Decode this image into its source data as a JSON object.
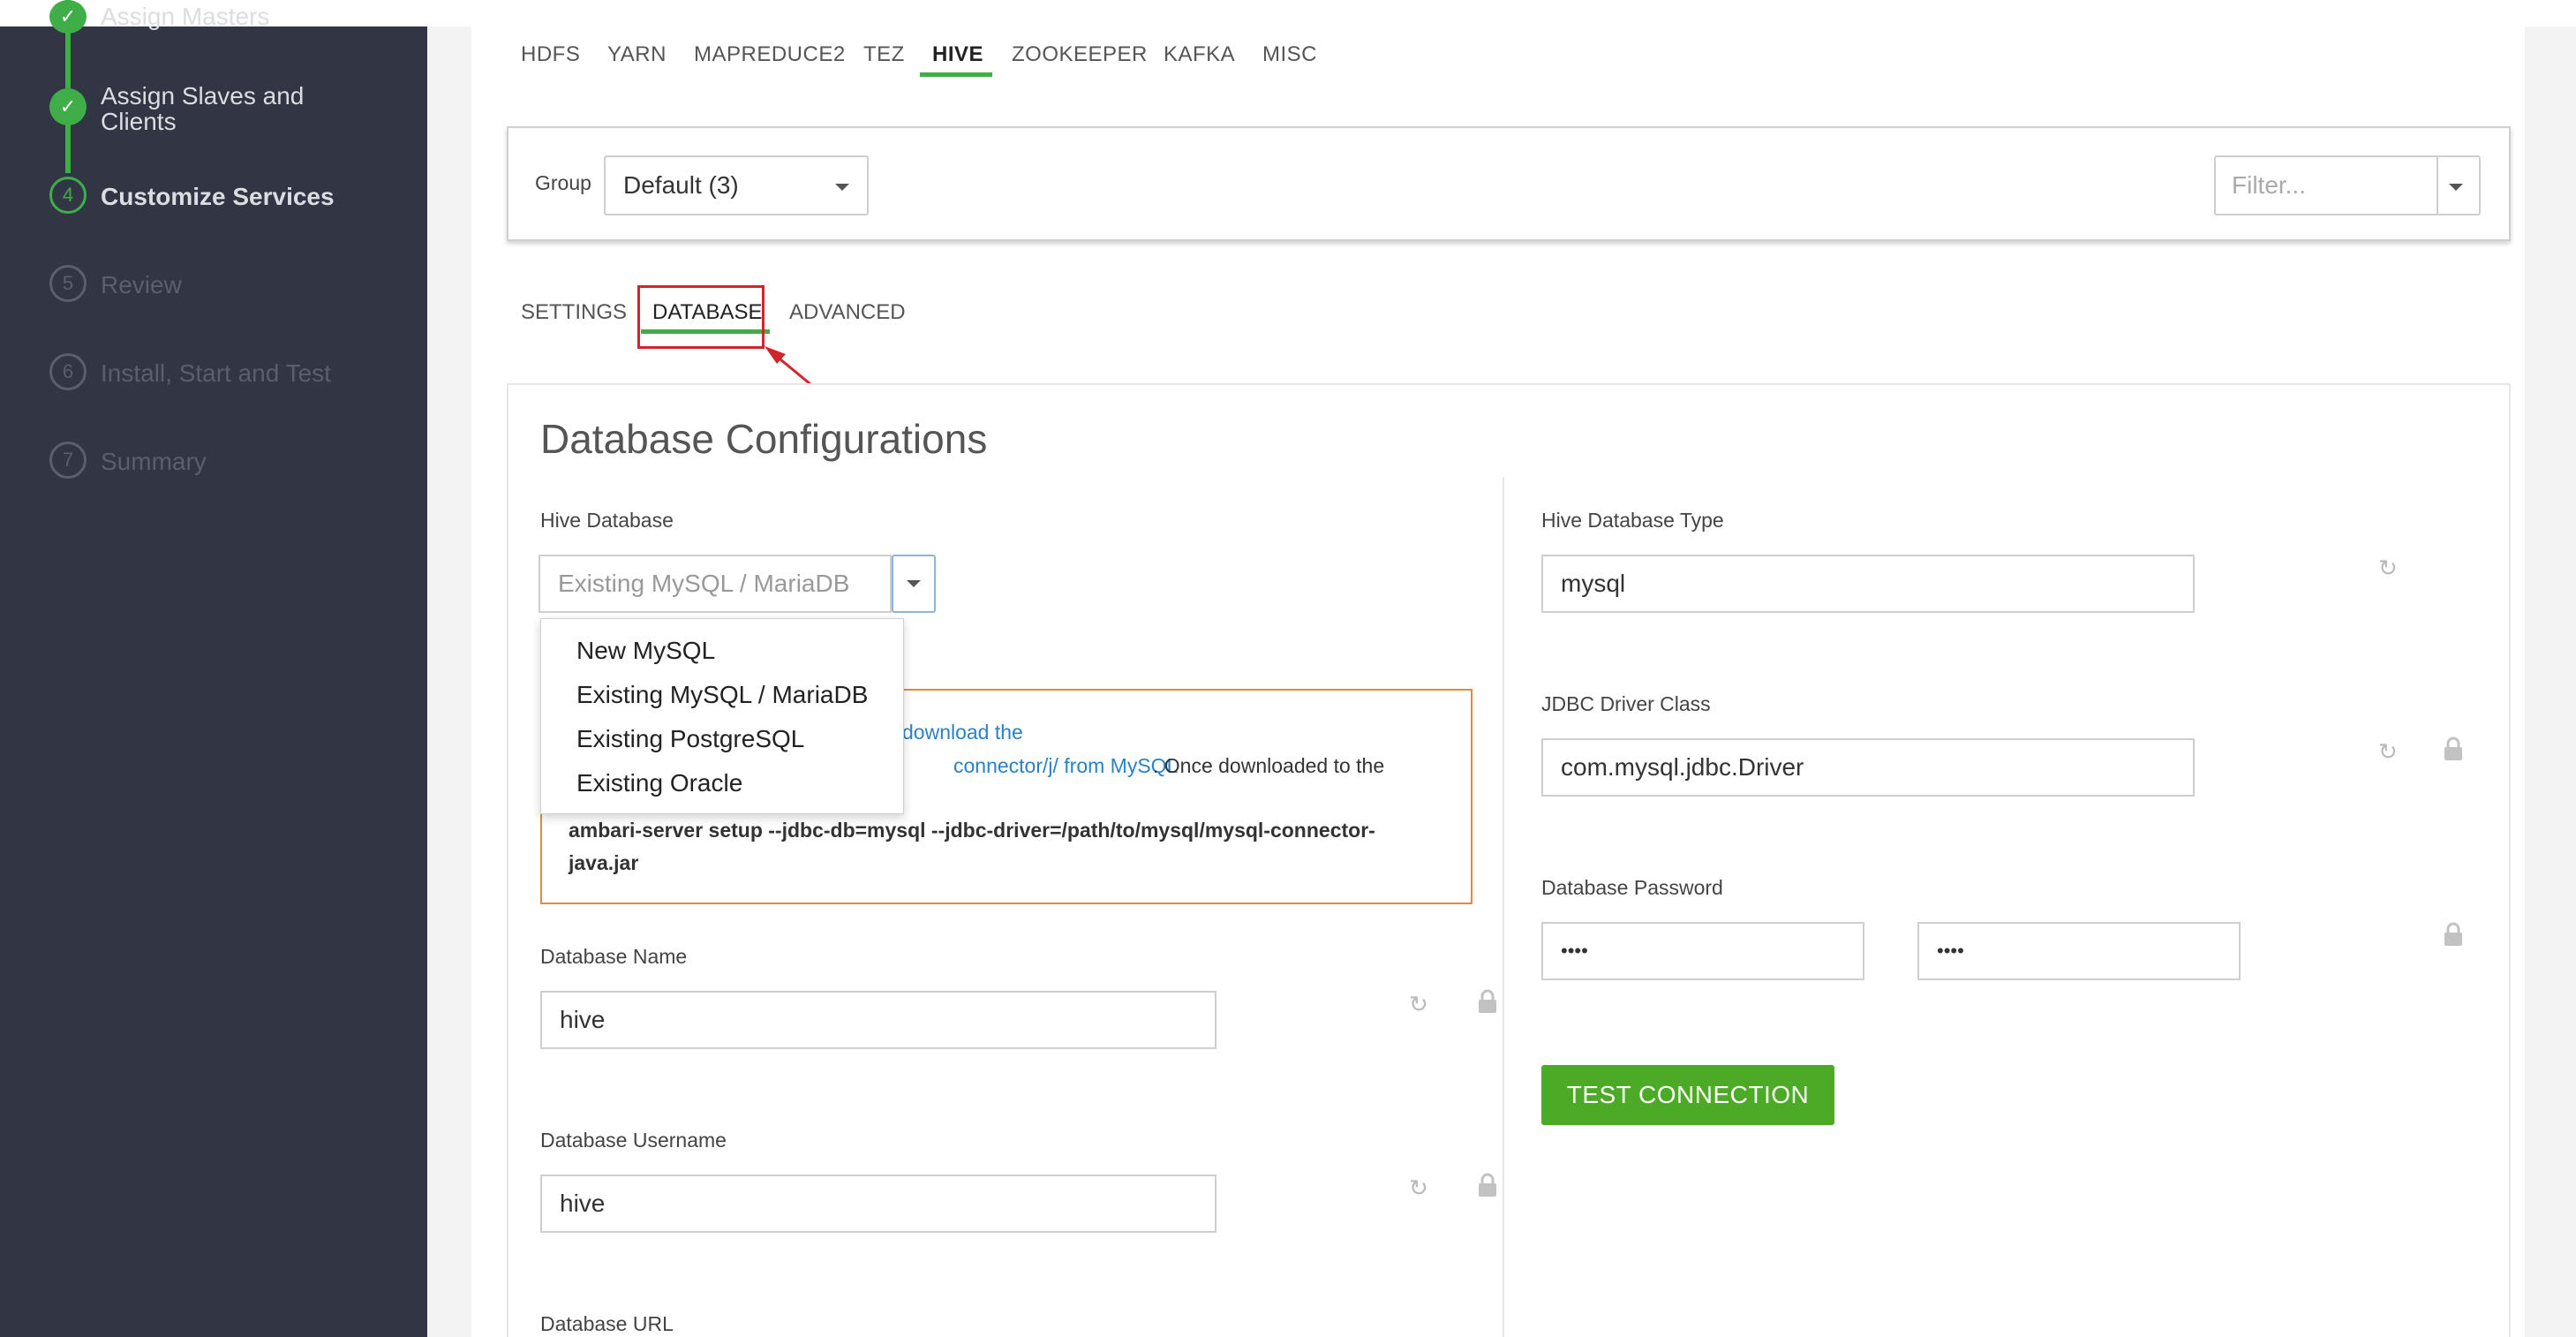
{
  "wizard_steps": [
    {
      "number": "",
      "label": "Assign Masters",
      "state": "done"
    },
    {
      "number": "",
      "label": "Assign Slaves and Clients",
      "state": "done"
    },
    {
      "number": "4",
      "label": "Customize Services",
      "state": "current"
    },
    {
      "number": "5",
      "label": "Review",
      "state": "future"
    },
    {
      "number": "6",
      "label": "Install, Start and Test",
      "state": "future"
    },
    {
      "number": "7",
      "label": "Summary",
      "state": "future"
    }
  ],
  "service_tabs": [
    "HDFS",
    "YARN",
    "MAPREDUCE2",
    "TEZ",
    "HIVE",
    "ZOOKEEPER",
    "KAFKA",
    "MISC"
  ],
  "active_service_tab": "HIVE",
  "group": {
    "label": "Group",
    "value": "Default (3)"
  },
  "filter": {
    "placeholder": "Filter..."
  },
  "sub_tabs": [
    "SETTINGS",
    "DATABASE",
    "ADVANCED"
  ],
  "active_sub_tab": "DATABASE",
  "section_title": "Database Configurations",
  "left_fields": {
    "hive_database": {
      "label": "Hive Database",
      "value": "Existing MySQL / MariaDB"
    },
    "database_name": {
      "label": "Database Name",
      "value": "hive"
    },
    "database_username": {
      "label": "Database Username",
      "value": "hive"
    },
    "database_url": {
      "label": "Database URL"
    }
  },
  "dropdown_options": [
    "New MySQL",
    "Existing MySQL / MariaDB",
    "Existing PostgreSQL",
    "Existing Oracle"
  ],
  "warning": {
    "link1": "download the",
    "link2": "connector/j/ from MySQL",
    "text_after_link": ". Once downloaded to the",
    "command": "ambari-server setup --jdbc-db=mysql --jdbc-driver=/path/to/mysql/mysql-connector-java.jar"
  },
  "right_fields": {
    "hive_database_type": {
      "label": "Hive Database Type",
      "value": "mysql"
    },
    "jdbc_driver_class": {
      "label": "JDBC Driver Class",
      "value": "com.mysql.jdbc.Driver"
    },
    "database_password": {
      "label": "Database Password",
      "value": "••••",
      "confirm": "••••"
    }
  },
  "test_connection_label": "TEST CONNECTION",
  "colors": {
    "sidebar_bg": "#323544",
    "accent_green": "#3fae49",
    "button_green": "#4daa27",
    "highlight_red": "#d0262a",
    "warning_orange": "#e58a3c",
    "link_blue": "#2a82c4"
  }
}
